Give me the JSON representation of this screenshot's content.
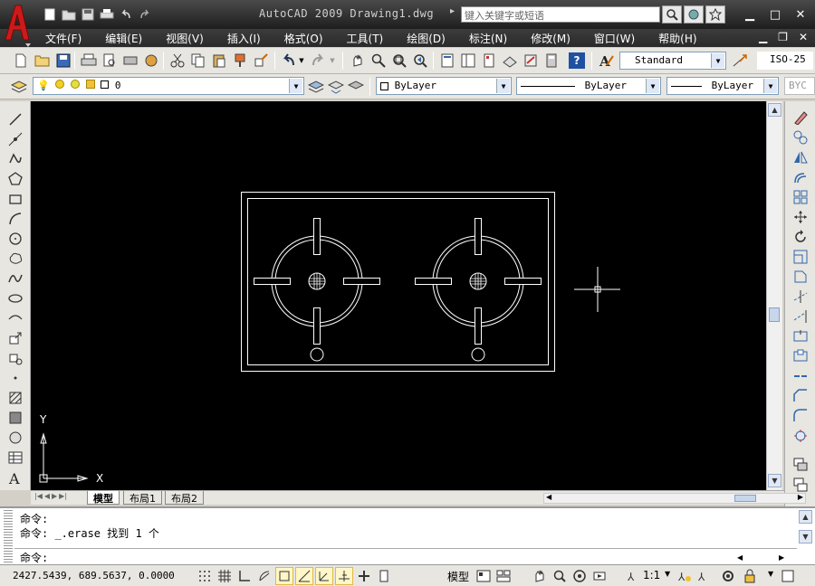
{
  "window": {
    "title": "AutoCAD 2009  Drawing1.dwg",
    "search_placeholder": "键入关键字或短语"
  },
  "menu": [
    "文件(F)",
    "编辑(E)",
    "视图(V)",
    "插入(I)",
    "格式(O)",
    "工具(T)",
    "绘图(D)",
    "标注(N)",
    "修改(M)",
    "窗口(W)",
    "帮助(H)"
  ],
  "toolbar": {
    "text_style": "Standard",
    "dim_style": "ISO-25",
    "layer": "0",
    "color": "ByLayer",
    "linetype": "ByLayer",
    "lineweight": "ByLayer",
    "plotstyle": "BYC"
  },
  "tabs": [
    "模型",
    "布局1",
    "布局2"
  ],
  "ucs": {
    "x_label": "X",
    "y_label": "Y"
  },
  "command": {
    "line1": "命令:",
    "line2": "命令: _.erase 找到 1 个",
    "prompt": "命令:"
  },
  "status": {
    "coords": "2427.5439, 689.5637, 0.0000",
    "model": "模型",
    "scale": "1:1"
  },
  "colors": {
    "canvas": "#000000",
    "drawing_lines": "#ffffff",
    "title_bar": "#2b2b2b",
    "logo": "#cc1a1a"
  }
}
